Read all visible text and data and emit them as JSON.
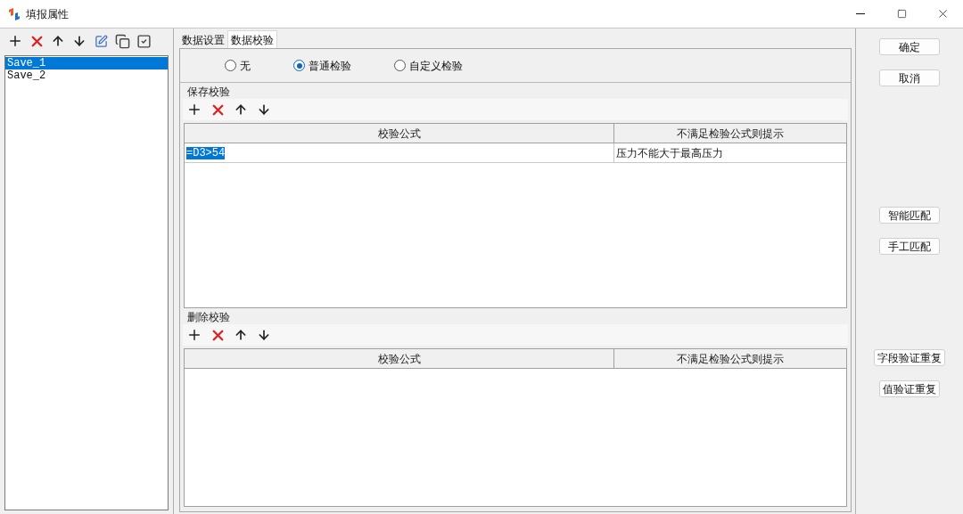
{
  "window": {
    "title": "填报属性"
  },
  "list": {
    "items": [
      {
        "label": "Save_1",
        "selected": true
      },
      {
        "label": "Save_2",
        "selected": false
      }
    ]
  },
  "tabs": [
    {
      "label": "数据设置",
      "selected": false
    },
    {
      "label": "数据校验",
      "selected": true
    }
  ],
  "radios": [
    {
      "label": "无",
      "selected": false
    },
    {
      "label": "普通检验",
      "selected": true
    },
    {
      "label": "自定义检验",
      "selected": false
    }
  ],
  "sections": [
    {
      "title": "保存校验",
      "columns": [
        "校验公式",
        "不满足检验公式则提示"
      ],
      "rows": [
        {
          "cells": [
            {
              "text": "=D3>54",
              "selected": true
            },
            {
              "text": "压力不能大于最高压力",
              "selected": false
            }
          ]
        }
      ]
    },
    {
      "title": "删除校验",
      "columns": [
        "校验公式",
        "不满足检验公式则提示"
      ]
    }
  ],
  "button_groups": [
    [
      "确定",
      "取消"
    ],
    [
      "智能匹配",
      "手工匹配"
    ],
    [
      "字段验证重复",
      "值验证重复"
    ]
  ]
}
